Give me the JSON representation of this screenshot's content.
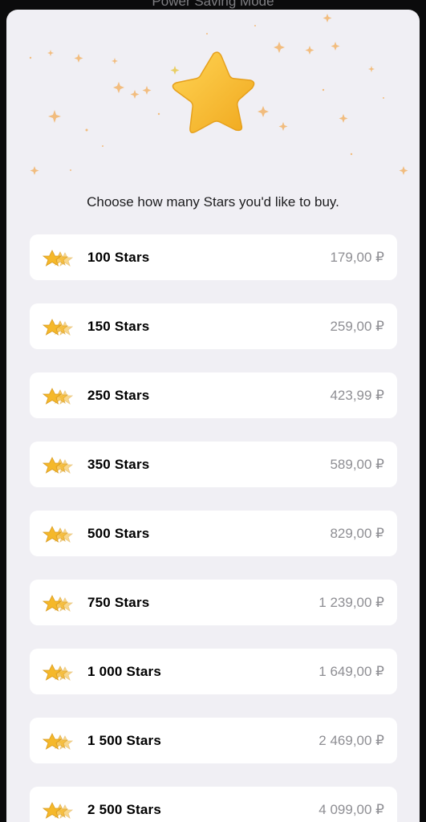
{
  "background_title": "Power Saving Mode",
  "subtitle": "Choose how many Stars you'd like to buy.",
  "colors": {
    "star_gold": "#f5b82a",
    "sheet_bg": "#f0eff4",
    "price_gray": "#8e8e93"
  },
  "options": [
    {
      "label": "100 Stars",
      "price": "179,00 ₽",
      "icon": "stars-stack-icon"
    },
    {
      "label": "150 Stars",
      "price": "259,00 ₽",
      "icon": "stars-stack-icon"
    },
    {
      "label": "250 Stars",
      "price": "423,99 ₽",
      "icon": "stars-stack-icon"
    },
    {
      "label": "350 Stars",
      "price": "589,00 ₽",
      "icon": "stars-stack-icon"
    },
    {
      "label": "500 Stars",
      "price": "829,00 ₽",
      "icon": "stars-stack-icon"
    },
    {
      "label": "750 Stars",
      "price": "1 239,00 ₽",
      "icon": "stars-stack-icon"
    },
    {
      "label": "1 000 Stars",
      "price": "1 649,00 ₽",
      "icon": "stars-stack-icon"
    },
    {
      "label": "1 500 Stars",
      "price": "2 469,00 ₽",
      "icon": "stars-stack-icon"
    },
    {
      "label": "2 500 Stars",
      "price": "4 099,00 ₽",
      "icon": "stars-stack-icon"
    }
  ]
}
